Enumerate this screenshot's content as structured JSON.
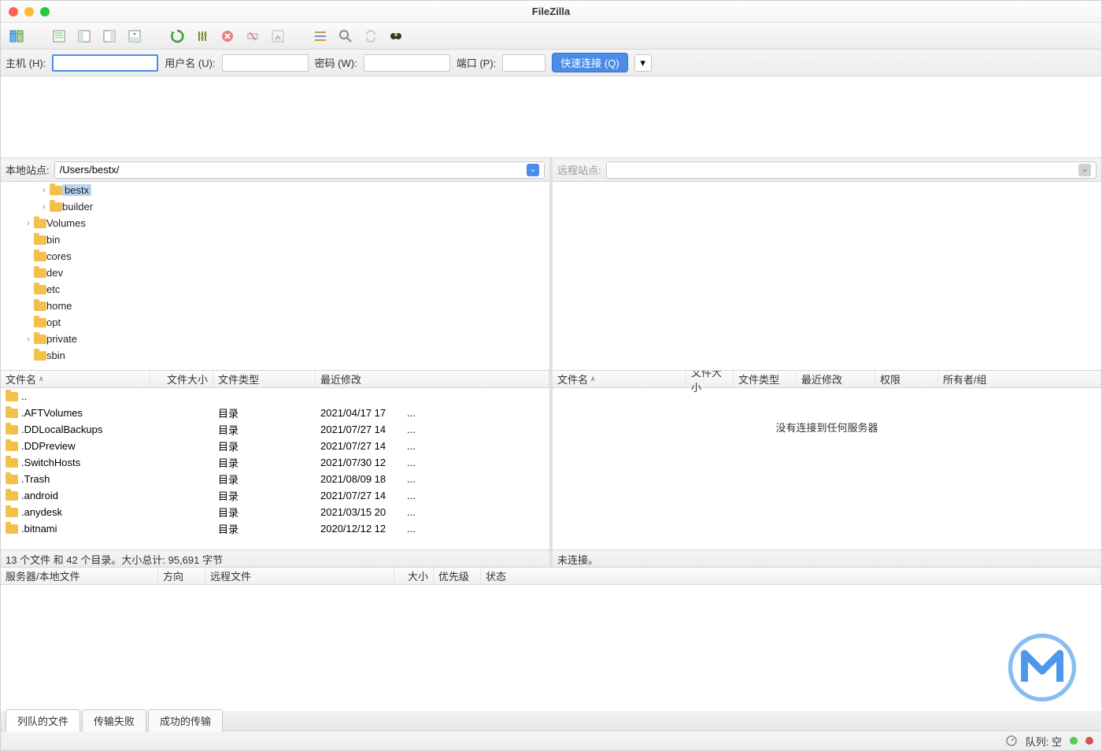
{
  "title": "FileZilla",
  "quickconnect": {
    "host_label": "主机 (H):",
    "user_label": "用户名 (U):",
    "pass_label": "密码 (W):",
    "port_label": "端口 (P):",
    "button": "快速连接 (Q)"
  },
  "site": {
    "local_label": "本地站点:",
    "local_path": "/Users/bestx/",
    "remote_label": "远程站点:"
  },
  "local_tree": [
    {
      "indent": 2,
      "exp": "›",
      "name": "bestx",
      "selected": true
    },
    {
      "indent": 2,
      "exp": "›",
      "name": "builder"
    },
    {
      "indent": 1,
      "exp": "›",
      "name": "Volumes"
    },
    {
      "indent": 1,
      "exp": "",
      "name": "bin"
    },
    {
      "indent": 1,
      "exp": "",
      "name": "cores"
    },
    {
      "indent": 1,
      "exp": "",
      "name": "dev"
    },
    {
      "indent": 1,
      "exp": "",
      "name": "etc"
    },
    {
      "indent": 1,
      "exp": "",
      "name": "home"
    },
    {
      "indent": 1,
      "exp": "",
      "name": "opt"
    },
    {
      "indent": 1,
      "exp": "›",
      "name": "private"
    },
    {
      "indent": 1,
      "exp": "",
      "name": "sbin"
    }
  ],
  "local_list_headers": {
    "name": "文件名",
    "size": "文件大小",
    "type": "文件类型",
    "modified": "最近修改"
  },
  "local_list": [
    {
      "name": "..",
      "size": "",
      "type": "",
      "modified": "",
      "dots": ""
    },
    {
      "name": ".AFTVolumes",
      "size": "",
      "type": "目录",
      "modified": "2021/04/17 17",
      "dots": "..."
    },
    {
      "name": ".DDLocalBackups",
      "size": "",
      "type": "目录",
      "modified": "2021/07/27 14",
      "dots": "..."
    },
    {
      "name": ".DDPreview",
      "size": "",
      "type": "目录",
      "modified": "2021/07/27 14",
      "dots": "..."
    },
    {
      "name": ".SwitchHosts",
      "size": "",
      "type": "目录",
      "modified": "2021/07/30 12",
      "dots": "..."
    },
    {
      "name": ".Trash",
      "size": "",
      "type": "目录",
      "modified": "2021/08/09 18",
      "dots": "..."
    },
    {
      "name": ".android",
      "size": "",
      "type": "目录",
      "modified": "2021/07/27 14",
      "dots": "..."
    },
    {
      "name": ".anydesk",
      "size": "",
      "type": "目录",
      "modified": "2021/03/15 20",
      "dots": "..."
    },
    {
      "name": ".bitnami",
      "size": "",
      "type": "目录",
      "modified": "2020/12/12 12",
      "dots": "..."
    }
  ],
  "remote_list_headers": {
    "name": "文件名",
    "size": "文件大小",
    "type": "文件类型",
    "modified": "最近修改",
    "perms": "权限",
    "owner": "所有者/组"
  },
  "remote_empty": "没有连接到任何服务器",
  "local_status": "13 个文件 和 42 个目录。大小总计: 95,691 字节",
  "remote_status": "未连接。",
  "queue_headers": {
    "server": "服务器/本地文件",
    "direction": "方向",
    "remote": "远程文件",
    "size": "大小",
    "priority": "优先级",
    "status": "状态"
  },
  "tabs": {
    "queued": "列队的文件",
    "failed": "传输失败",
    "success": "成功的传输"
  },
  "statusbar": {
    "queue": "队列: 空"
  }
}
